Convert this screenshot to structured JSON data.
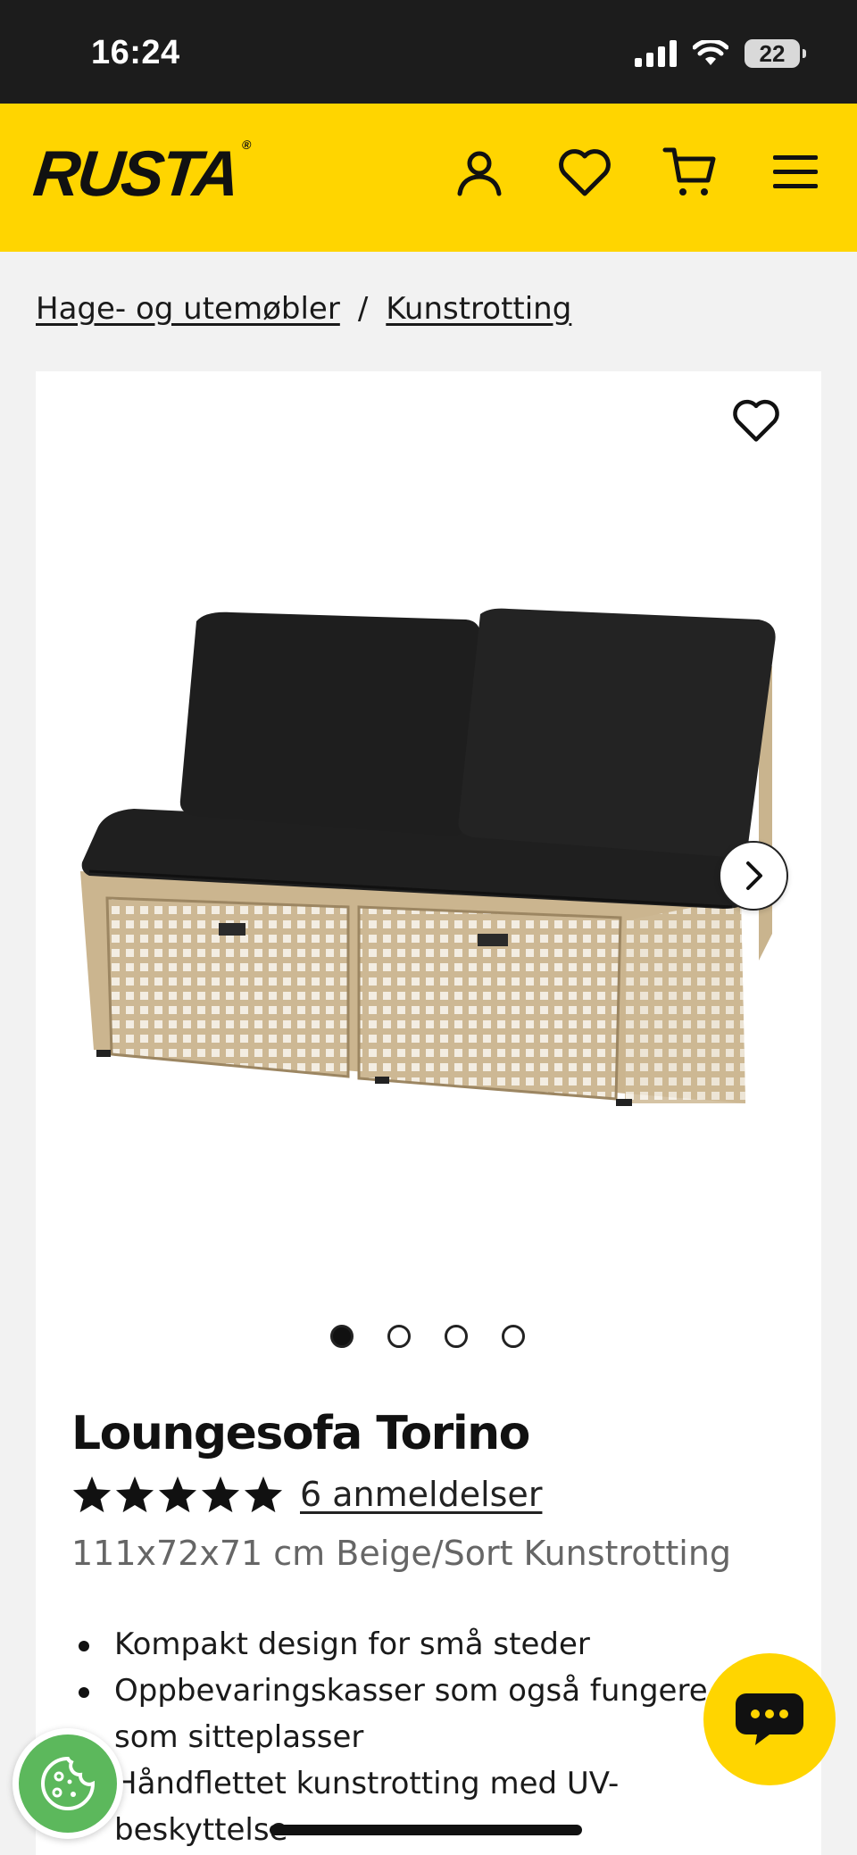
{
  "status_bar": {
    "time": "16:24",
    "battery": "22"
  },
  "header": {
    "logo": "RUSTA",
    "logo_mark": "®"
  },
  "breadcrumb": {
    "items": [
      "Hage- og utemøbler",
      "Kunstrotting"
    ],
    "separator": "/"
  },
  "gallery": {
    "image_count": 4,
    "active_index": 0
  },
  "product": {
    "title": "Loungesofa Torino",
    "rating": 5,
    "rating_max": 5,
    "reviews": "6 anmeldelser",
    "subtitle": "111x72x71 cm Beige/Sort Kunstrotting",
    "bullets": [
      "Kompakt design for små steder",
      "Oppbevaringskasser som også fungerer som sitteplasser",
      "Håndflettet kunstrotting med UV-beskyttelse"
    ],
    "bullet_lines": [
      "Kompakt design for små steder",
      "Oppbevaringskasser som også fungere",
      "som sitteplasser",
      "Håndflettet kunstrotting med UV-",
      "beskyttelse"
    ]
  },
  "colors": {
    "brand_yellow": "#ffd500",
    "status_bar": "#1c1c1c",
    "cookie_green": "#5cb85c"
  }
}
